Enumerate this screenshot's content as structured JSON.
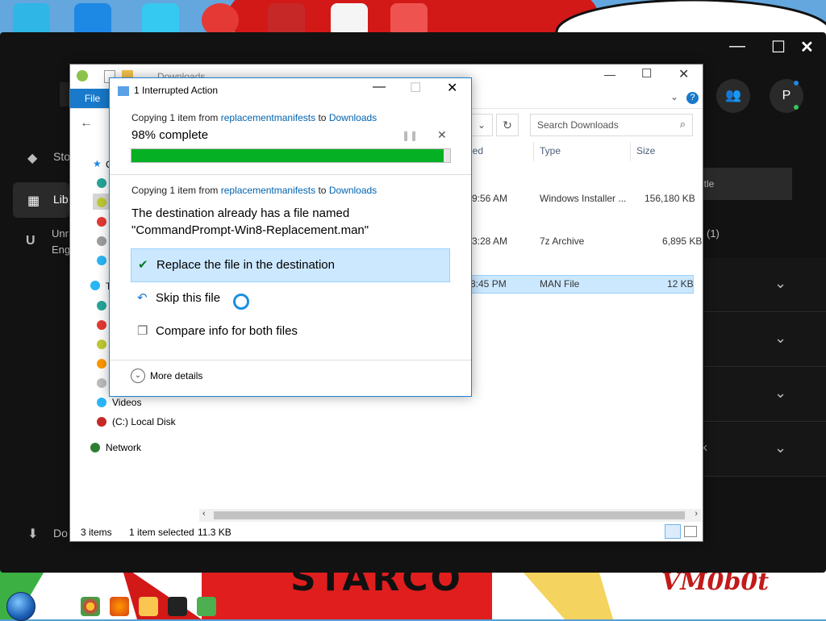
{
  "epic": {
    "nav": {
      "store": "Sto",
      "library": "Lib",
      "unreal": "Unr",
      "engine": "Eng",
      "downloads": "Do"
    },
    "avatar_initial": "P",
    "right_title": "itle",
    "right_badge": "(1)",
    "right_row4": "k"
  },
  "explorer": {
    "title": "Downloads",
    "file_tab": "File",
    "search_placeholder": "Search Downloads",
    "columns": {
      "modified": "ied",
      "type": "Type",
      "size": "Size"
    },
    "rows": [
      {
        "time": "9:56 AM",
        "type": "Windows Installer ...",
        "size": "156,180 KB"
      },
      {
        "time": "3:28 AM",
        "type": "7z Archive",
        "size": "6,895 KB"
      },
      {
        "time": "8:45 PM",
        "type": "MAN File",
        "size": "12 KB"
      }
    ],
    "nav_items": {
      "quick": "C",
      "this_pc": "T",
      "videos": "Videos",
      "local_disk": "(C:) Local Disk",
      "network": "Network"
    },
    "status": {
      "items": "3 items",
      "selected": "1 item selected",
      "size": "11.3 KB"
    }
  },
  "dialog": {
    "title": "1 Interrupted Action",
    "top": {
      "copying": "Copying 1 item from",
      "source": "replacementmanifests",
      "to": "to",
      "dest": "Downloads",
      "percent_label": "98% complete",
      "progress": 0.98
    },
    "conflict": {
      "copying": "Copying 1 item from",
      "source": "replacementmanifests",
      "to": "to",
      "dest": "Downloads",
      "message1": "The destination already has a file named",
      "message2": "\"CommandPrompt-Win8-Replacement.man\""
    },
    "options": {
      "replace": "Replace the file in the destination",
      "skip": "Skip this file",
      "compare": "Compare info for both files"
    },
    "more_details": "More details"
  },
  "wallpaper": {
    "watermark": "VM0b0t",
    "banner": "STARCO"
  },
  "colors": {
    "progress_green": "#06b025",
    "link_blue": "#0063b1",
    "selection": "#cce8ff"
  }
}
